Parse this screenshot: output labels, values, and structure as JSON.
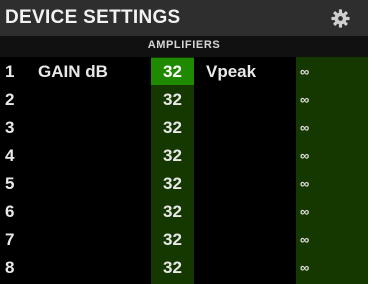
{
  "header": {
    "title": "DEVICE SETTINGS",
    "settings_icon": "gear-icon"
  },
  "section": {
    "label": "AMPLIFIERS"
  },
  "columns": {
    "gain_label": "GAIN dB",
    "vpeak_label": "Vpeak"
  },
  "channels": [
    {
      "number": "1",
      "gain": "32",
      "vpeak": "∞"
    },
    {
      "number": "2",
      "gain": "32",
      "vpeak": "∞"
    },
    {
      "number": "3",
      "gain": "32",
      "vpeak": "∞"
    },
    {
      "number": "4",
      "gain": "32",
      "vpeak": "∞"
    },
    {
      "number": "5",
      "gain": "32",
      "vpeak": "∞"
    },
    {
      "number": "6",
      "gain": "32",
      "vpeak": "∞"
    },
    {
      "number": "7",
      "gain": "32",
      "vpeak": "∞"
    },
    {
      "number": "8",
      "gain": "32",
      "vpeak": "∞"
    }
  ],
  "colors": {
    "title_bar": "#2e2e2e",
    "column_highlight": "#143800",
    "selected_cell": "#1f8a00"
  }
}
